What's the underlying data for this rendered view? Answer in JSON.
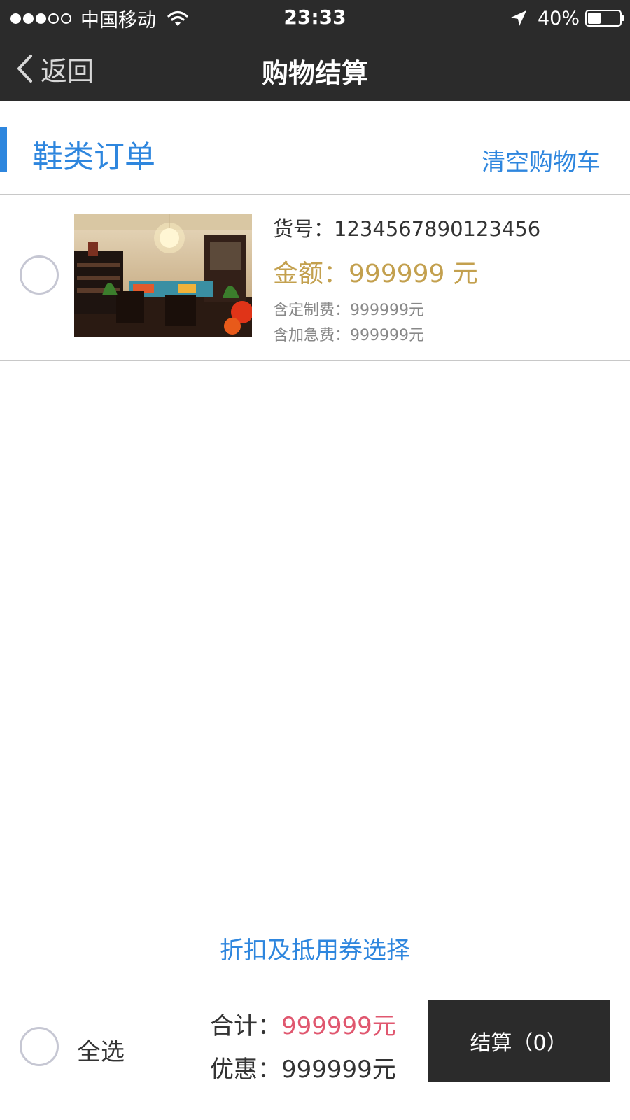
{
  "status_bar": {
    "carrier": "中国移动",
    "time": "23:33",
    "battery": "40%",
    "battery_level": 0.4,
    "signal_filled": 3,
    "signal_total": 5
  },
  "nav": {
    "back_label": "返回",
    "title": "购物结算"
  },
  "section": {
    "title": "鞋类订单",
    "clear_label": "清空购物车"
  },
  "order_item": {
    "item_no_label": "货号：",
    "item_no": "1234567890123456",
    "amount_label": "金额：",
    "amount": "999999 元",
    "custom_fee": "含定制费：999999元",
    "rush_fee": "含加急费：999999元"
  },
  "discount_link": "折扣及抵用券选择",
  "footer": {
    "select_all": "全选",
    "total_label": "合计：",
    "total_value": "999999元",
    "discount_label": "优惠：",
    "discount_value": "999999元",
    "checkout_label": "结算（0）"
  },
  "colors": {
    "accent": "#2e86de",
    "bar": "#2b2b2b",
    "amount_gold": "#c3a04e",
    "total_red": "#e0576f"
  },
  "icons": {
    "back": "chevron-left-icon",
    "wifi": "wifi-icon",
    "location": "location-arrow-icon",
    "battery": "battery-icon",
    "radio": "radio-circle-icon"
  }
}
